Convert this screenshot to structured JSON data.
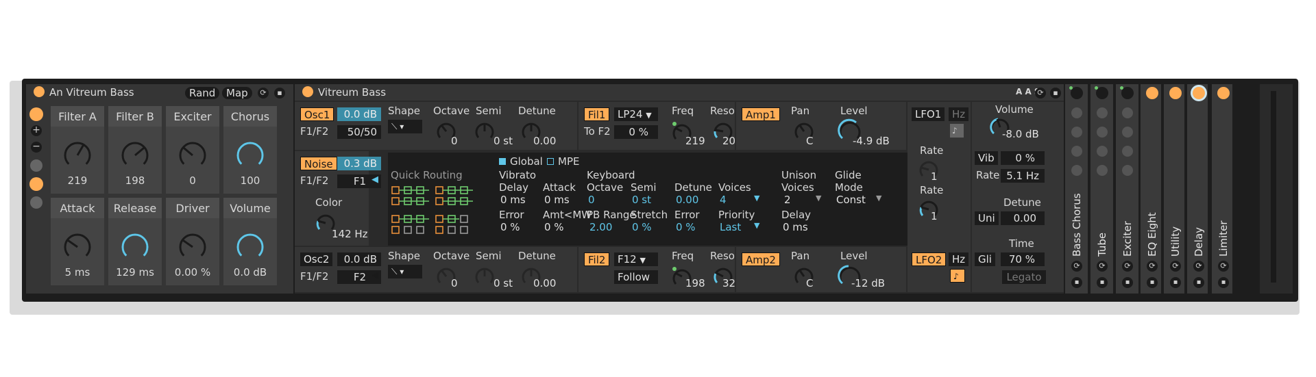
{
  "rack": {
    "title": "An Vitreum Bass",
    "rand": "Rand",
    "map": "Map",
    "macros": [
      {
        "label": "Filter A",
        "value": "219"
      },
      {
        "label": "Filter B",
        "value": "198"
      },
      {
        "label": "Exciter",
        "value": "0"
      },
      {
        "label": "Chorus",
        "value": "100"
      },
      {
        "label": "Attack",
        "value": "5 ms"
      },
      {
        "label": "Release",
        "value": "129 ms"
      },
      {
        "label": "Driver",
        "value": "0.00 %"
      },
      {
        "label": "Volume",
        "value": "0.0 dB"
      }
    ]
  },
  "synth": {
    "title": "Vitreum Bass",
    "osc1": {
      "btn": "Osc1",
      "gain": "0.0 dB",
      "f1f2_label": "F1/F2",
      "f1f2": "50/50",
      "shape": "Shape",
      "octave": "Octave",
      "octave_val": "0",
      "semi": "Semi",
      "semi_val": "0 st",
      "detune": "Detune",
      "detune_val": "0.00"
    },
    "noise": {
      "btn": "Noise",
      "gain": "0.3 dB",
      "f1f2_label": "F1/F2",
      "f1f2": "F1",
      "color": "Color",
      "color_val": "142 Hz"
    },
    "osc2": {
      "btn": "Osc2",
      "gain": "0.0 dB",
      "f1f2_label": "F1/F2",
      "f1f2": "F2",
      "shape": "Shape",
      "octave": "Octave",
      "octave_val": "0",
      "semi": "Semi",
      "semi_val": "0 st",
      "detune": "Detune",
      "detune_val": "0.00"
    },
    "fil1": {
      "btn": "Fil1",
      "type": "LP24",
      "tof2": "To F2",
      "tof2_val": "0 %",
      "freq": "Freq",
      "freq_val": "219",
      "reso": "Reso",
      "reso_val": "20 %"
    },
    "fil2": {
      "btn": "Fil2",
      "type": "F12",
      "follow": "Follow",
      "freq": "Freq",
      "freq_val": "198",
      "reso": "Reso",
      "reso_val": "32 %"
    },
    "amp1": {
      "btn": "Amp1",
      "pan": "Pan",
      "pan_val": "C",
      "level": "Level",
      "level_val": "-4.9 dB"
    },
    "amp2": {
      "btn": "Amp2",
      "pan": "Pan",
      "pan_val": "C",
      "level": "Level",
      "level_val": "-12 dB"
    },
    "lfo1": {
      "btn": "LFO1",
      "hz": "Hz",
      "rate": "Rate",
      "rate_val": "1"
    },
    "lfo2": {
      "btn": "LFO2",
      "hz": "Hz",
      "rate": "Rate",
      "rate_val": "1"
    },
    "global": {
      "global": "Global",
      "mpe": "MPE",
      "quick_routing": "Quick Routing",
      "vibrato": "Vibrato",
      "delay": "Delay",
      "delay_val": "0 ms",
      "attack": "Attack",
      "attack_val": "0 ms",
      "error": "Error",
      "error_val": "0 %",
      "amtmw": "Amt<MW",
      "amtmw_val": "0 %",
      "keyboard": "Keyboard",
      "octave": "Octave",
      "octave_val": "0",
      "semi": "Semi",
      "semi_val": "0 st",
      "detune": "Detune",
      "detune_val": "0.00",
      "voices": "Voices",
      "voices_val": "4",
      "pbrange": "PB Range",
      "pbrange_val": "2.00",
      "stretch": "Stretch",
      "stretch_val": "0 %",
      "kerror": "Error",
      "kerror_val": "0 %",
      "priority": "Priority",
      "priority_val": "Last",
      "unison": "Unison",
      "unison_voices": "Voices",
      "unison_voices_val": "2",
      "unison_delay": "Delay",
      "unison_delay_val": "0 ms",
      "glide": "Glide",
      "glide_mode": "Mode",
      "glide_mode_val": "Const"
    },
    "right": {
      "volume": "Volume",
      "volume_val": "-8.0 dB",
      "vib": "Vib",
      "vib_val": "0 %",
      "rate": "Rate",
      "rate_val": "5.1 Hz",
      "detune": "Detune",
      "uni": "Uni",
      "detune_val": "0.00",
      "time": "Time",
      "gli": "Gli",
      "time_val": "70 %",
      "legato": "Legato",
      "aas": "A A S"
    }
  },
  "chain": [
    "Bass Chorus",
    "Tube",
    "Exciter",
    "EQ Eight",
    "Utility",
    "Delay",
    "Limiter"
  ],
  "colors": {
    "accent": "#ffad56",
    "cyan": "#5fc6e8",
    "green": "#6ecc6e"
  }
}
